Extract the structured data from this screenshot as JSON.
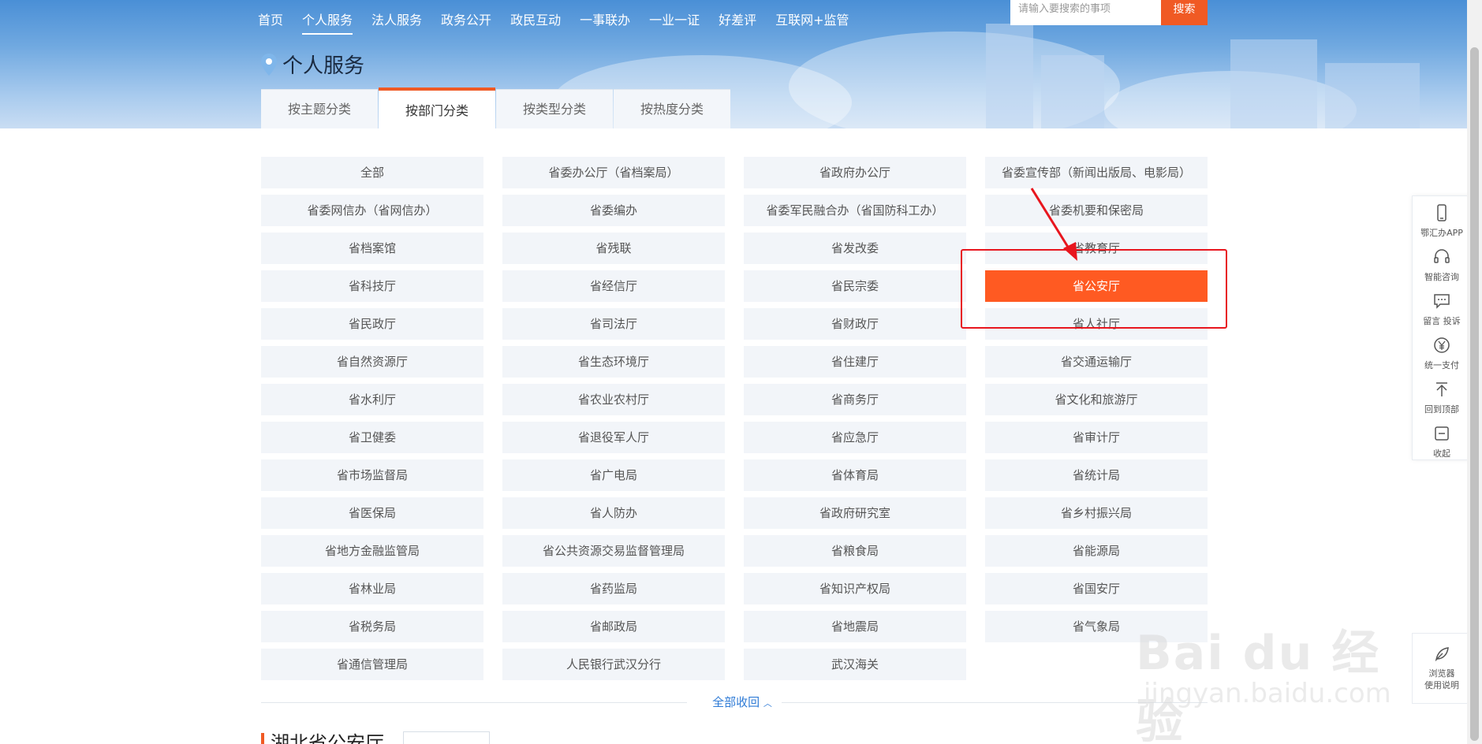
{
  "nav": {
    "items": [
      "首页",
      "个人服务",
      "法人服务",
      "政务公开",
      "政民互动",
      "一事联办",
      "一业一证",
      "好差评",
      "互联网+监管"
    ],
    "active_index": 1
  },
  "search": {
    "placeholder": "请输入要搜索的事项",
    "button": "搜索"
  },
  "page_title": "个人服务",
  "tabs": [
    "按主题分类",
    "按部门分类",
    "按类型分类",
    "按热度分类"
  ],
  "active_tab": 1,
  "departments": [
    "全部",
    "省委办公厅（省档案局）",
    "省政府办公厅",
    "省委宣传部（新闻出版局、电影局）",
    "省委网信办（省网信办）",
    "省委编办",
    "省委军民融合办（省国防科工办）",
    "省委机要和保密局",
    "省档案馆",
    "省残联",
    "省发改委",
    "省教育厅",
    "省科技厅",
    "省经信厅",
    "省民宗委",
    "省公安厅",
    "省民政厅",
    "省司法厅",
    "省财政厅",
    "省人社厅",
    "省自然资源厅",
    "省生态环境厅",
    "省住建厅",
    "省交通运输厅",
    "省水利厅",
    "省农业农村厅",
    "省商务厅",
    "省文化和旅游厅",
    "省卫健委",
    "省退役军人厅",
    "省应急厅",
    "省审计厅",
    "省市场监督局",
    "省广电局",
    "省体育局",
    "省统计局",
    "省医保局",
    "省人防办",
    "省政府研究室",
    "省乡村振兴局",
    "省地方金融监管局",
    "省公共资源交易监督管理局",
    "省粮食局",
    "省能源局",
    "省林业局",
    "省药监局",
    "省知识产权局",
    "省国安厅",
    "省税务局",
    "省邮政局",
    "省地震局",
    "省气象局",
    "省通信管理局",
    "人民银行武汉分行",
    "武汉海关"
  ],
  "selected_department": "省公安厅",
  "collapse_label": "全部收回",
  "section_title": "湖北省公安厅",
  "side_tools": [
    {
      "icon": "phone-icon",
      "label": "鄂汇办APP"
    },
    {
      "icon": "headset-icon",
      "label": "智能咨询"
    },
    {
      "icon": "message-icon",
      "label": "留言 投诉"
    },
    {
      "icon": "yen-icon",
      "label": "统一支付"
    },
    {
      "icon": "back-to-top-icon",
      "label": "回到顶部"
    },
    {
      "icon": "collapse-icon",
      "label": "收起"
    }
  ],
  "browser_help": {
    "line1": "浏览器",
    "line2": "使用说明"
  },
  "watermark": {
    "main": "Bai du 经验",
    "sub": "jingyan.baidu.com"
  },
  "colors": {
    "accent": "#ff5a22",
    "link": "#2f7bd6",
    "highlight_frame": "#e8161e"
  }
}
